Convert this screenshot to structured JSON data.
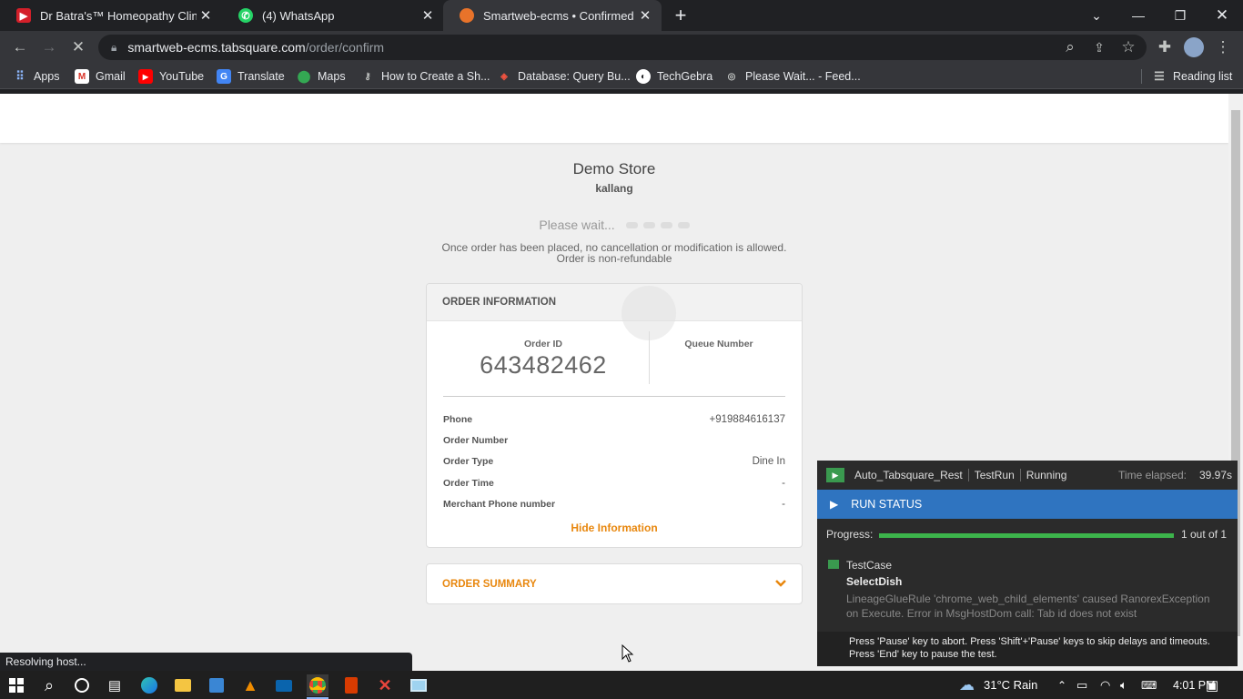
{
  "tabs": [
    {
      "title": "Dr Batra's™ Homeopathy Clinics",
      "favicon_color": "#d4202a",
      "favicon_name": "dr-batras-icon"
    },
    {
      "title": "(4) WhatsApp",
      "favicon_color": "#25d366",
      "favicon_name": "whatsapp-icon"
    },
    {
      "title": "Smartweb-ecms • Confirmed Ord",
      "favicon_color": "#e8732a",
      "favicon_name": "smartweb-icon",
      "active": true
    }
  ],
  "address_bar": {
    "host": "smartweb-ecms.tabsquare.com",
    "path": "/order/confirm"
  },
  "bookmarks": [
    {
      "label": "Apps",
      "icon": "apps-grid-icon"
    },
    {
      "label": "Gmail",
      "icon": "gmail-icon"
    },
    {
      "label": "YouTube",
      "icon": "youtube-icon"
    },
    {
      "label": "Translate",
      "icon": "translate-icon"
    },
    {
      "label": "Maps",
      "icon": "maps-icon"
    },
    {
      "label": "How to Create a Sh...",
      "icon": "key-icon"
    },
    {
      "label": "Database: Query Bu...",
      "icon": "laravel-icon"
    },
    {
      "label": "TechGebra",
      "icon": "techgebra-icon"
    },
    {
      "label": "Please Wait... - Feed...",
      "icon": "feed-icon"
    }
  ],
  "reading_list": "Reading list",
  "store": {
    "name": "Demo Store",
    "location": "kallang"
  },
  "please_wait": "Please wait...",
  "notice": "Once order has been placed, no cancellation or modification is allowed. Order is non-refundable",
  "order_info": {
    "heading": "ORDER INFORMATION",
    "order_id_label": "Order ID",
    "order_id": "643482462",
    "queue_label": "Queue Number",
    "rows": [
      {
        "label": "Phone",
        "value": "+919884616137"
      },
      {
        "label": "Order Number",
        "value": ""
      },
      {
        "label": "Order Type",
        "value": "Dine In"
      },
      {
        "label": "Order Time",
        "value": "-"
      },
      {
        "label": "Merchant Phone number",
        "value": "-"
      }
    ],
    "hide_link": "Hide Information"
  },
  "order_summary": {
    "heading": "ORDER SUMMARY"
  },
  "status_text": "Resolving host...",
  "ranorex": {
    "project": "Auto_Tabsquare_Rest",
    "run": "TestRun",
    "state": "Running",
    "elapsed_label": "Time elapsed:",
    "elapsed": "39.97s",
    "run_status": "RUN STATUS",
    "progress_label": "Progress:",
    "progress_fraction": 1.0,
    "progress_text": "1 out of 1",
    "testcase_label": "TestCase",
    "step": "SelectDish",
    "error": "LineageGlueRule 'chrome_web_child_elements' caused RanorexException on Execute. Error in MsgHostDom call: Tab id does not exist",
    "hint": "Press 'Pause' key to abort. Press 'Shift'+'Pause' keys to skip delays and timeouts. Press 'End' key to pause the test."
  },
  "tray": {
    "weather": "31°C  Rain",
    "time": "4:01 PM"
  },
  "colors": {
    "accent_orange": "#e8870e",
    "ranorex_blue": "#2f74c0",
    "progress_green": "#3cb44b"
  }
}
